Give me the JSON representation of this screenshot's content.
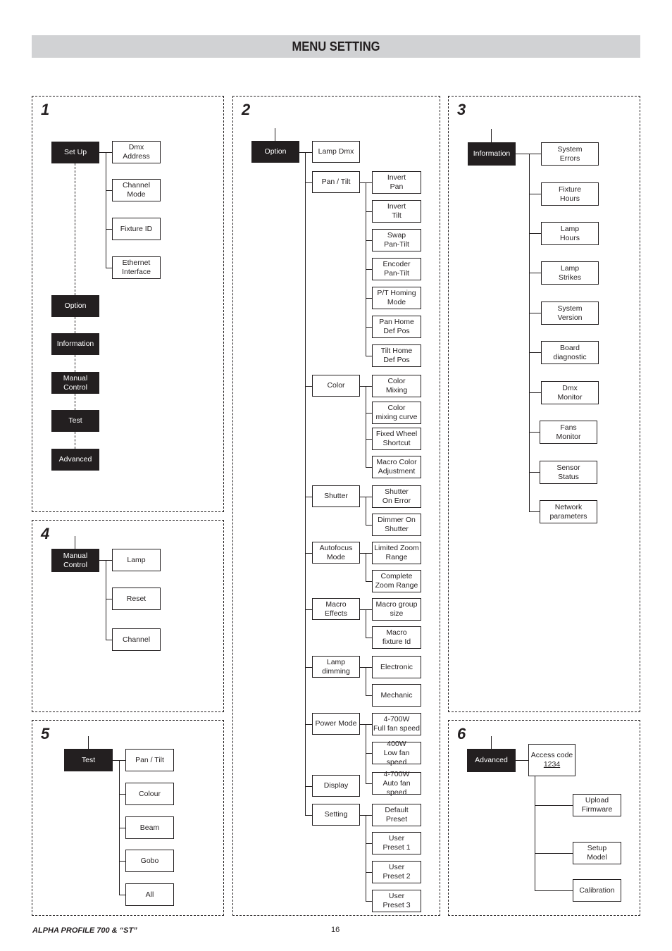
{
  "page": {
    "title": "MENU SETTING",
    "footer_left": "ALPHA PROFILE 700 & “ST”",
    "page_number": "16"
  },
  "panels": [
    {
      "number": "1",
      "root_items": [
        "Set Up",
        "Option",
        "Information",
        "Manual\nControl",
        "Test",
        "Advanced"
      ],
      "children": [
        "Dmx\nAddress",
        "Channel\nMode",
        "Fixture ID",
        "Ethernet\nInterface"
      ]
    },
    {
      "number": "2",
      "root": "Option",
      "children": [
        {
          "label": "Lamp Dmx",
          "children": []
        },
        {
          "label": "Pan / Tilt",
          "children": [
            "Invert\nPan",
            "Invert\nTilt",
            "Swap\nPan-Tilt",
            "Encoder\nPan-Tilt",
            "P/T Homing\nMode",
            "Pan Home\nDef Pos",
            "Tilt Home\nDef Pos"
          ]
        },
        {
          "label": "Color",
          "children": [
            "Color\nMixing",
            "Color\nmixing curve",
            "Fixed Wheel\nShortcut",
            "Macro Color\nAdjustment"
          ]
        },
        {
          "label": "Shutter",
          "children": [
            "Shutter\nOn Error",
            "Dimmer On\nShutter"
          ]
        },
        {
          "label": "Autofocus\nMode",
          "children": [
            "Limited Zoom\nRange",
            "Complete\nZoom Range"
          ]
        },
        {
          "label": "Macro\nEffects",
          "children": [
            "Macro group\nsize",
            "Macro\nfixture Id"
          ]
        },
        {
          "label": "Lamp\ndimming",
          "children": [
            "Electronic",
            "Mechanic"
          ]
        },
        {
          "label": "Power Mode",
          "children": [
            "4-700W\nFull fan speed",
            "400W\nLow fan speed",
            "4-700W\nAuto fan speed"
          ]
        },
        {
          "label": "Display",
          "children": []
        },
        {
          "label": "Setting",
          "children": [
            "Default\nPreset",
            "User\nPreset 1",
            "User\nPreset 2",
            "User\nPreset 3"
          ]
        }
      ]
    },
    {
      "number": "3",
      "root": "Information",
      "children": [
        "System\nErrors",
        "Fixture\nHours",
        "Lamp\nHours",
        "Lamp\nStrikes",
        "System\nVersion",
        "Board\ndiagnostic",
        "Dmx\nMonitor",
        "Fans\nMonitor",
        "Sensor\nStatus",
        "Network\nparameters"
      ]
    },
    {
      "number": "4",
      "root": "Manual\nControl",
      "children": [
        "Lamp",
        "Reset",
        "Channel"
      ]
    },
    {
      "number": "5",
      "root": "Test",
      "children": [
        "Pan / Tilt",
        "Colour",
        "Beam",
        "Gobo",
        "All"
      ]
    },
    {
      "number": "6",
      "root": "Advanced",
      "access": {
        "label": "Access code",
        "code": "1234"
      },
      "children": [
        "Upload\nFirmware",
        "Setup\nModel",
        "Calibration"
      ]
    }
  ]
}
